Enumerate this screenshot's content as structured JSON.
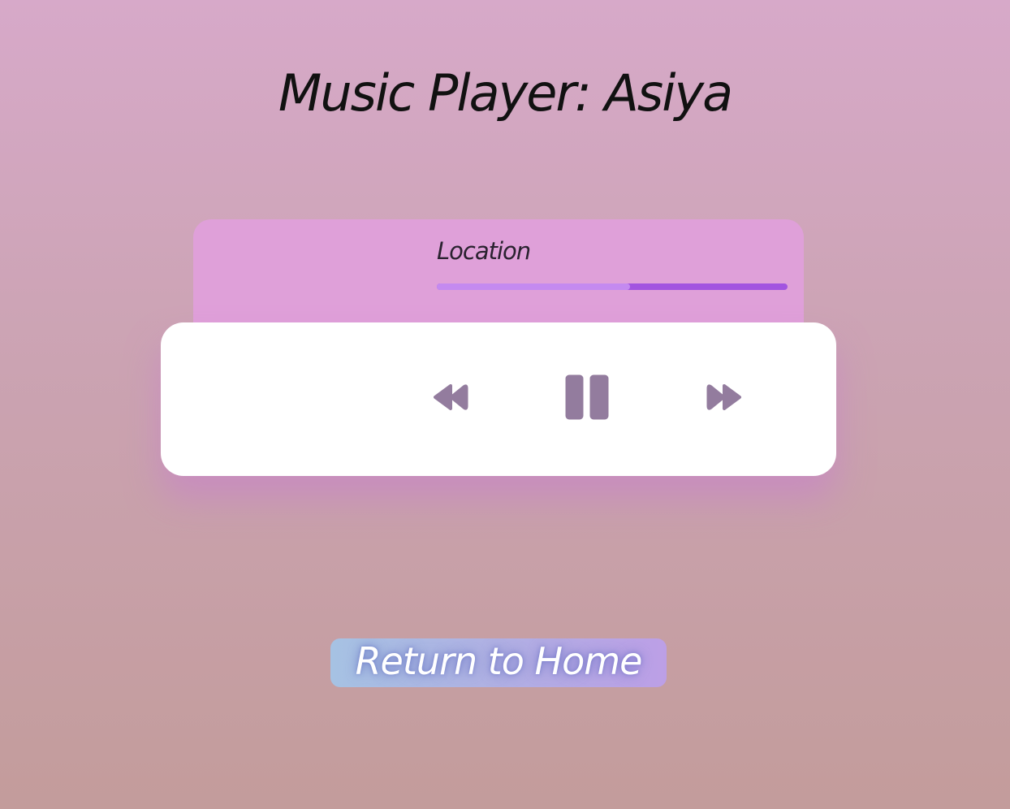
{
  "header": {
    "title": "Music Player: Asiya"
  },
  "player": {
    "location_label": "Location",
    "progress_fraction": 0.55,
    "controls": {
      "rewind_icon": "rewind-icon",
      "pause_icon": "pause-icon",
      "forward_icon": "fast-forward-icon",
      "icon_color": "#937c9e"
    }
  },
  "footer": {
    "home_label": "Return to Home"
  },
  "colors": {
    "info_card": "#dfa0d9",
    "progress_fill": "#c48af0",
    "progress_track": "#a254e0",
    "controls_card": "#ffffff"
  }
}
